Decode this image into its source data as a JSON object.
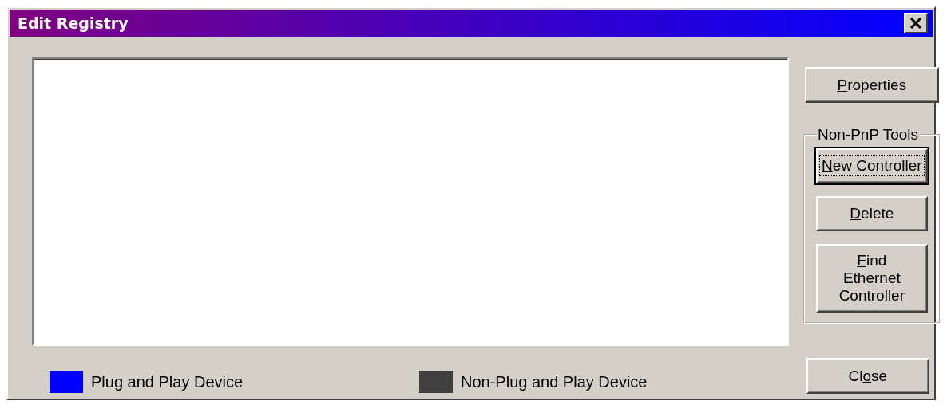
{
  "window": {
    "title": "Edit Registry"
  },
  "buttons": [
    {
      "kind": "button",
      "parts": {
        "key": "P",
        "rest": "roperties"
      },
      "focused": false
    },
    {
      "kind": "group",
      "label": "Non-PnP Tools",
      "buttons": [
        {
          "parts": {
            "key": "N",
            "rest": "ew Controller"
          },
          "focused": true
        },
        {
          "parts": {
            "key": "D",
            "rest": "elete"
          },
          "focused": false
        },
        {
          "parts": {
            "key": "F",
            "rest": "ind Ethernet Controller"
          },
          "focused": false
        }
      ]
    },
    {
      "kind": "button",
      "parts": {
        "lead": "Cl",
        "key": "o",
        "rest": "se"
      },
      "focused": false
    }
  ],
  "legend": [
    {
      "label": "Plug and Play Device",
      "color": "#0000ff"
    },
    {
      "label": "Non-Plug and Play Device",
      "color": "#404040"
    }
  ]
}
